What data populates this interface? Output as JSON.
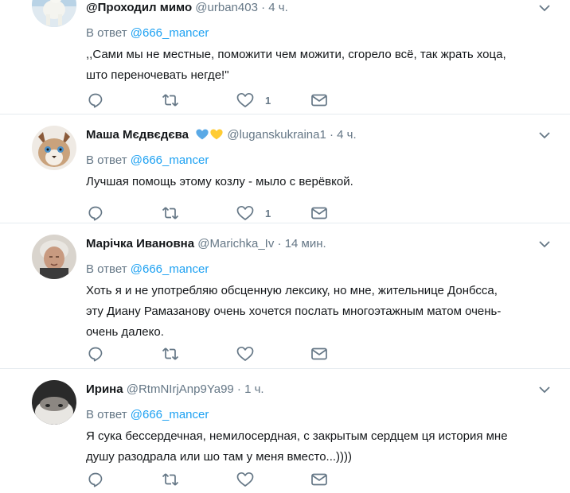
{
  "tweets": [
    {
      "name": "@Проходил мимо",
      "handle": "@urban403",
      "separator": "·",
      "time": "4 ч.",
      "reply_prefix": "В ответ",
      "reply_to": "@666_mancer",
      "text_lines": [
        ",,Сами мы не местные, поможити чем можити, сгорело всё, так жрать хоца,",
        "што переночевать негде!\""
      ],
      "likes": "1"
    },
    {
      "name": "Маша Мєдвєдєва",
      "handle": "@luganskukraina1",
      "separator": "·",
      "time": "4 ч.",
      "reply_prefix": "В ответ",
      "reply_to": "@666_mancer",
      "text_lines": [
        "Лучшая помощь этому козлу - мыло с верёвкой."
      ],
      "likes": "1"
    },
    {
      "name": "Марічка Ивановна",
      "handle": "@Marichka_Iv",
      "separator": "·",
      "time": "14 мин.",
      "reply_prefix": "В ответ",
      "reply_to": "@666_mancer",
      "text_lines": [
        "Хоть я и не употребляю обсценную лексику, но мне, жительнице Донбсса,",
        "эту Диану Рамазанову очень хочется послать многоэтажным матом очень-",
        "очень далеко."
      ],
      "likes": ""
    },
    {
      "name": "Ирина",
      "handle": "@RtmNIrjAnp9Ya99",
      "separator": "·",
      "time": "1 ч.",
      "reply_prefix": "В ответ",
      "reply_to": "@666_mancer",
      "text_lines": [
        "Я сука бессердечная, немилосердная, с закрытым сердцем ця история мне",
        "душу разодрала или шо там у меня вместо...))))"
      ],
      "likes": ""
    }
  ],
  "icons": {
    "reply": "reply-icon",
    "retweet": "retweet-icon",
    "like": "heart-icon",
    "dm": "envelope-icon",
    "more": "chevron-down-icon"
  },
  "colors": {
    "text": "#14171a",
    "secondary": "#657786",
    "link": "#1da1f2",
    "divider": "#e6ecf0",
    "heart_blue": "#5aa9e6",
    "heart_yellow": "#ffcc33"
  }
}
